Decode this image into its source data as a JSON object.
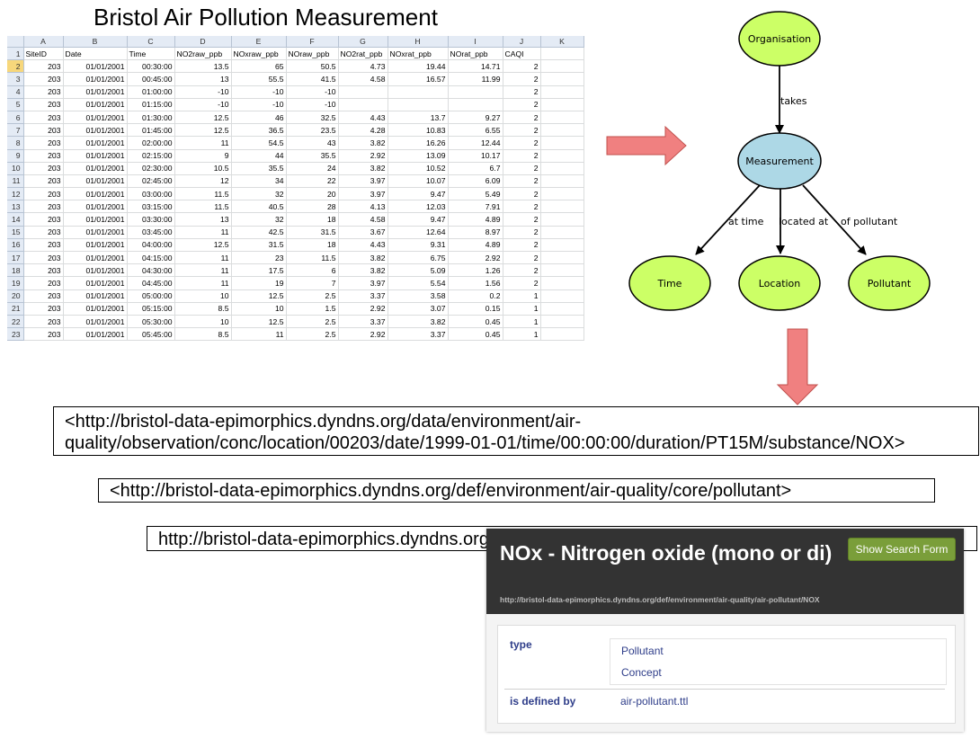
{
  "title": "Bristol Air Pollution Measurement",
  "spreadsheet": {
    "columns": [
      "A",
      "B",
      "C",
      "D",
      "E",
      "F",
      "G",
      "H",
      "I",
      "J",
      "K"
    ],
    "header_row": [
      "SiteID",
      "Date",
      "Time",
      "NO2raw_ppb",
      "NOxraw_ppb",
      "NOraw_ppb",
      "NO2rat_ppb",
      "NOxrat_ppb",
      "NOrat_ppb",
      "CAQI",
      ""
    ],
    "rows": [
      [
        "203",
        "01/01/2001",
        "00:30:00",
        "13.5",
        "65",
        "50.5",
        "4.73",
        "19.44",
        "14.71",
        "2",
        ""
      ],
      [
        "203",
        "01/01/2001",
        "00:45:00",
        "13",
        "55.5",
        "41.5",
        "4.58",
        "16.57",
        "11.99",
        "2",
        ""
      ],
      [
        "203",
        "01/01/2001",
        "01:00:00",
        "-10",
        "-10",
        "-10",
        "",
        "",
        "",
        "2",
        ""
      ],
      [
        "203",
        "01/01/2001",
        "01:15:00",
        "-10",
        "-10",
        "-10",
        "",
        "",
        "",
        "2",
        ""
      ],
      [
        "203",
        "01/01/2001",
        "01:30:00",
        "12.5",
        "46",
        "32.5",
        "4.43",
        "13.7",
        "9.27",
        "2",
        ""
      ],
      [
        "203",
        "01/01/2001",
        "01:45:00",
        "12.5",
        "36.5",
        "23.5",
        "4.28",
        "10.83",
        "6.55",
        "2",
        ""
      ],
      [
        "203",
        "01/01/2001",
        "02:00:00",
        "11",
        "54.5",
        "43",
        "3.82",
        "16.26",
        "12.44",
        "2",
        ""
      ],
      [
        "203",
        "01/01/2001",
        "02:15:00",
        "9",
        "44",
        "35.5",
        "2.92",
        "13.09",
        "10.17",
        "2",
        ""
      ],
      [
        "203",
        "01/01/2001",
        "02:30:00",
        "10.5",
        "35.5",
        "24",
        "3.82",
        "10.52",
        "6.7",
        "2",
        ""
      ],
      [
        "203",
        "01/01/2001",
        "02:45:00",
        "12",
        "34",
        "22",
        "3.97",
        "10.07",
        "6.09",
        "2",
        ""
      ],
      [
        "203",
        "01/01/2001",
        "03:00:00",
        "11.5",
        "32",
        "20",
        "3.97",
        "9.47",
        "5.49",
        "2",
        ""
      ],
      [
        "203",
        "01/01/2001",
        "03:15:00",
        "11.5",
        "40.5",
        "28",
        "4.13",
        "12.03",
        "7.91",
        "2",
        ""
      ],
      [
        "203",
        "01/01/2001",
        "03:30:00",
        "13",
        "32",
        "18",
        "4.58",
        "9.47",
        "4.89",
        "2",
        ""
      ],
      [
        "203",
        "01/01/2001",
        "03:45:00",
        "11",
        "42.5",
        "31.5",
        "3.67",
        "12.64",
        "8.97",
        "2",
        ""
      ],
      [
        "203",
        "01/01/2001",
        "04:00:00",
        "12.5",
        "31.5",
        "18",
        "4.43",
        "9.31",
        "4.89",
        "2",
        ""
      ],
      [
        "203",
        "01/01/2001",
        "04:15:00",
        "11",
        "23",
        "11.5",
        "3.82",
        "6.75",
        "2.92",
        "2",
        ""
      ],
      [
        "203",
        "01/01/2001",
        "04:30:00",
        "11",
        "17.5",
        "6",
        "3.82",
        "5.09",
        "1.26",
        "2",
        ""
      ],
      [
        "203",
        "01/01/2001",
        "04:45:00",
        "11",
        "19",
        "7",
        "3.97",
        "5.54",
        "1.56",
        "2",
        ""
      ],
      [
        "203",
        "01/01/2001",
        "05:00:00",
        "10",
        "12.5",
        "2.5",
        "3.37",
        "3.58",
        "0.2",
        "1",
        ""
      ],
      [
        "203",
        "01/01/2001",
        "05:15:00",
        "8.5",
        "10",
        "1.5",
        "2.92",
        "3.07",
        "0.15",
        "1",
        ""
      ],
      [
        "203",
        "01/01/2001",
        "05:30:00",
        "10",
        "12.5",
        "2.5",
        "3.37",
        "3.82",
        "0.45",
        "1",
        ""
      ],
      [
        "203",
        "01/01/2001",
        "05:45:00",
        "8.5",
        "11",
        "2.5",
        "2.92",
        "3.37",
        "0.45",
        "1",
        ""
      ]
    ]
  },
  "graph": {
    "nodes": {
      "organisation": "Organisation",
      "measurement": "Measurement",
      "time": "Time",
      "location": "Location",
      "pollutant": "Pollutant"
    },
    "edges": {
      "takes": "takes",
      "at_time": "at time",
      "located_at": "located at",
      "of_pollutant": "of pollutant"
    },
    "colors": {
      "class_node": "#ccff66",
      "event_node": "#add8e6",
      "arrow_fill": "#f08080"
    }
  },
  "uris": {
    "observation": "<http://bristol-data-epimorphics.dyndns.org/data/environment/air-quality/observation/conc/location/00203/date/1999-01-01/time/00:00:00/duration/PT15M/substance/NOX>",
    "pollutant_def": "<http://bristol-data-epimorphics.dyndns.org/def/environment/air-quality/core/pollutant>",
    "partial": "http://bristol-data-epimorphics.dyndns.org/def/environment/air-quality/air-pollutant/NOX>"
  },
  "card": {
    "title": "NOx - Nitrogen oxide (mono or di)",
    "url": "http://bristol-data-epimorphics.dyndns.org/def/environment/air-quality/air-pollutant/NOX",
    "search_button": "Show Search Form",
    "type_label": "type",
    "type_values": [
      "Pollutant",
      "Concept"
    ],
    "defined_label": "is defined by",
    "defined_value": "air-pollutant.ttl"
  }
}
